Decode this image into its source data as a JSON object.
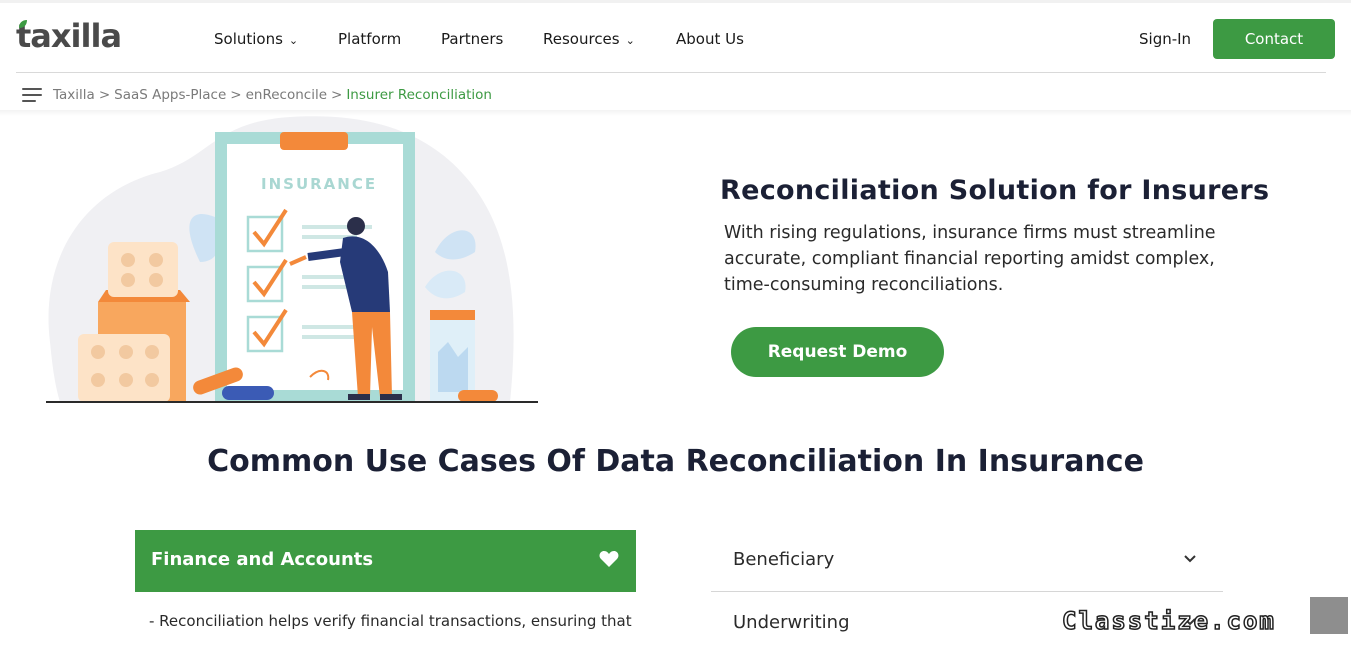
{
  "header": {
    "logo_text": "taxilla",
    "nav": [
      {
        "label": "Solutions",
        "has_dropdown": true
      },
      {
        "label": "Platform",
        "has_dropdown": false
      },
      {
        "label": "Partners",
        "has_dropdown": false
      },
      {
        "label": "Resources",
        "has_dropdown": true
      },
      {
        "label": "About Us",
        "has_dropdown": false
      }
    ],
    "signin_label": "Sign-In",
    "contact_label": "Contact"
  },
  "breadcrumb": {
    "items": [
      "Taxilla",
      "SaaS Apps-Place",
      "enReconcile"
    ],
    "current": "Insurer Reconciliation",
    "separator": ">"
  },
  "hero": {
    "illustration_label": "INSURANCE",
    "title": "Reconciliation Solution for Insurers",
    "description": "With rising regulations, insurance firms must streamline accurate, compliant financial reporting amidst complex, time-consuming reconciliations.",
    "cta_label": "Request Demo"
  },
  "use_cases": {
    "title": "Common Use Cases Of Data Reconciliation In Insurance",
    "left": [
      {
        "label": "Finance and Accounts",
        "expanded": true,
        "text": "- Reconciliation helps verify financial transactions, ensuring that"
      }
    ],
    "right": [
      {
        "label": "Beneficiary",
        "expanded": false
      },
      {
        "label": "Underwriting",
        "expanded": false
      }
    ]
  },
  "watermark": "Classtize.com",
  "colors": {
    "brand_green": "#3d9a43",
    "accent_orange": "#f3893a",
    "navy": "#1b2035"
  }
}
